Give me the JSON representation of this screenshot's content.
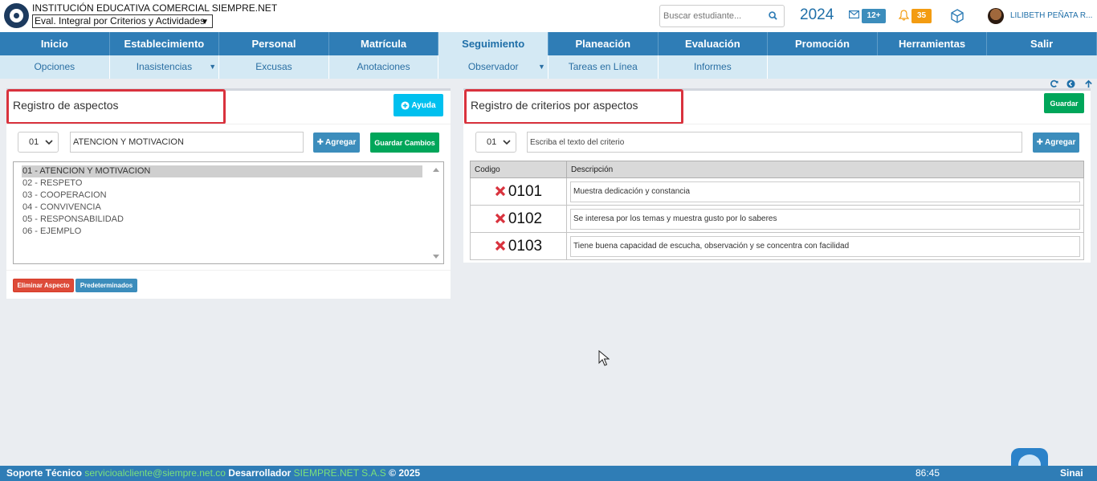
{
  "header": {
    "institution": "INSTITUCIÓN EDUCATIVA COMERCIAL SIEMPRE.NET",
    "module_selected": "Eval. Integral por Criterios y Actividades",
    "search_placeholder": "Buscar estudiante...",
    "year": "2024",
    "messages_count": "12+",
    "notifications_count": "35",
    "user_name": "LILIBETH PEÑATA R..."
  },
  "main_nav": [
    {
      "label": "Inicio"
    },
    {
      "label": "Establecimiento"
    },
    {
      "label": "Personal"
    },
    {
      "label": "Matrícula"
    },
    {
      "label": "Seguimiento"
    },
    {
      "label": "Planeación"
    },
    {
      "label": "Evaluación"
    },
    {
      "label": "Promoción"
    },
    {
      "label": "Herramientas"
    },
    {
      "label": "Salir"
    }
  ],
  "sub_nav": [
    {
      "label": "Opciones"
    },
    {
      "label": "Inasistencias"
    },
    {
      "label": "Excusas"
    },
    {
      "label": "Anotaciones"
    },
    {
      "label": "Observador"
    },
    {
      "label": "Tareas en Línea"
    },
    {
      "label": "Informes"
    }
  ],
  "left_panel": {
    "title": "Registro de aspectos",
    "help_label": "Ayuda",
    "code_value": "01",
    "aspect_value": "ATENCION Y MOTIVACION",
    "add_label": "Agregar",
    "save_label": "Guardar Cambios",
    "aspects": [
      "01 - ATENCION Y MOTIVACION",
      "02 - RESPETO",
      "03 - COOPERACION",
      "04 - CONVIVENCIA",
      "05 - RESPONSABILIDAD",
      "06 - EJEMPLO"
    ],
    "delete_label": "Eliminar Aspecto",
    "defaults_label": "Predeterminados"
  },
  "right_panel": {
    "title": "Registro de criterios por aspectos",
    "save_label": "Guardar",
    "code_value": "01",
    "criterion_placeholder": "Escriba el texto del criterio",
    "add_label": "Agregar",
    "columns": {
      "code": "Codigo",
      "description": "Descripción"
    },
    "criteria": [
      {
        "code": "0101",
        "description": "Muestra dedicación y constancia"
      },
      {
        "code": "0102",
        "description": "Se interesa por los temas y muestra gusto por lo saberes"
      },
      {
        "code": "0103",
        "description": "Tiene buena capacidad de escucha, observación y se concentra con facilidad"
      }
    ]
  },
  "footer": {
    "support_label": "Soporte Técnico",
    "support_email": "servicioalcliente@siempre.net.co",
    "developer_label": "Desarrollador",
    "developer_name": "SIEMPRE.NET S.A.S",
    "copyright": "© 2025",
    "timer": "86:45",
    "brand": "Sinai"
  },
  "colors": {
    "nav": "#2f7db6",
    "subnav": "#d4e9f4",
    "highlight_box": "#d9323d",
    "success": "#00a65a",
    "danger": "#dd4b39"
  }
}
